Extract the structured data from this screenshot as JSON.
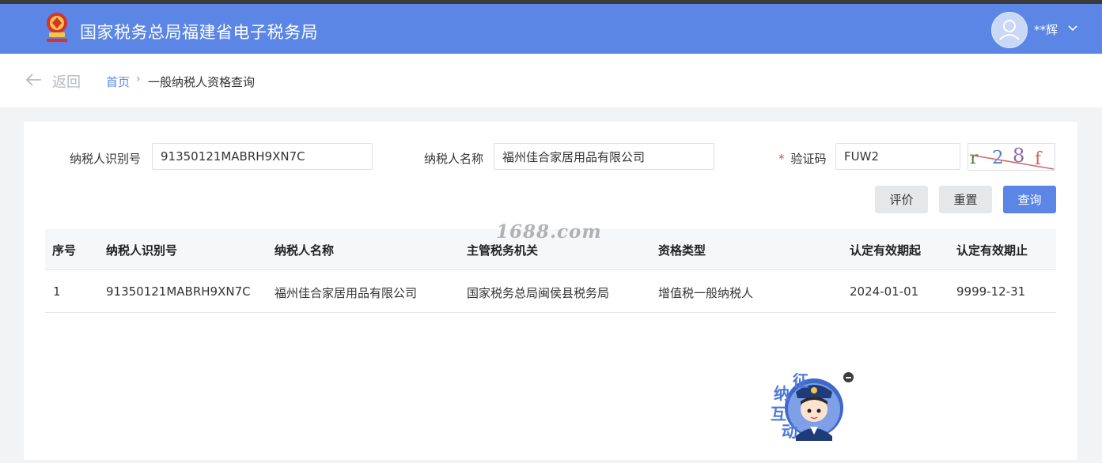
{
  "header": {
    "title": "国家税务总局福建省电子税务局",
    "username": "**辉",
    "colors": {
      "bar": "#5b86e5",
      "strip": "#3a3a3c"
    }
  },
  "breadcrumb": {
    "back_label": "返回",
    "home": "首页",
    "separator": "›",
    "current": "一般纳税人资格查询"
  },
  "form": {
    "taxpayer_id_label": "纳税人识别号",
    "taxpayer_id_value": "91350121MABRH9XN7C",
    "taxpayer_name_label": "纳税人名称",
    "taxpayer_name_value": "福州佳合家居用品有限公司",
    "captcha_required_mark": "*",
    "captcha_label": "验证码",
    "captcha_value": "FUW2",
    "captcha_image_text": "r28f"
  },
  "buttons": {
    "evaluate": "评价",
    "reset": "重置",
    "query": "查询"
  },
  "table": {
    "columns": [
      "序号",
      "纳税人识别号",
      "纳税人名称",
      "主管税务机关",
      "资格类型",
      "认定有效期起",
      "认定有效期止"
    ],
    "rows": [
      [
        "1",
        "91350121MABRH9XN7C",
        "福州佳合家居用品有限公司",
        "国家税务总局闽侯县税务局",
        "增值税一般纳税人",
        "2024-01-01",
        "9999-12-31"
      ]
    ]
  },
  "watermark": "1688.com",
  "mascot": {
    "chars": [
      "征",
      "纳",
      "互",
      "动"
    ]
  }
}
